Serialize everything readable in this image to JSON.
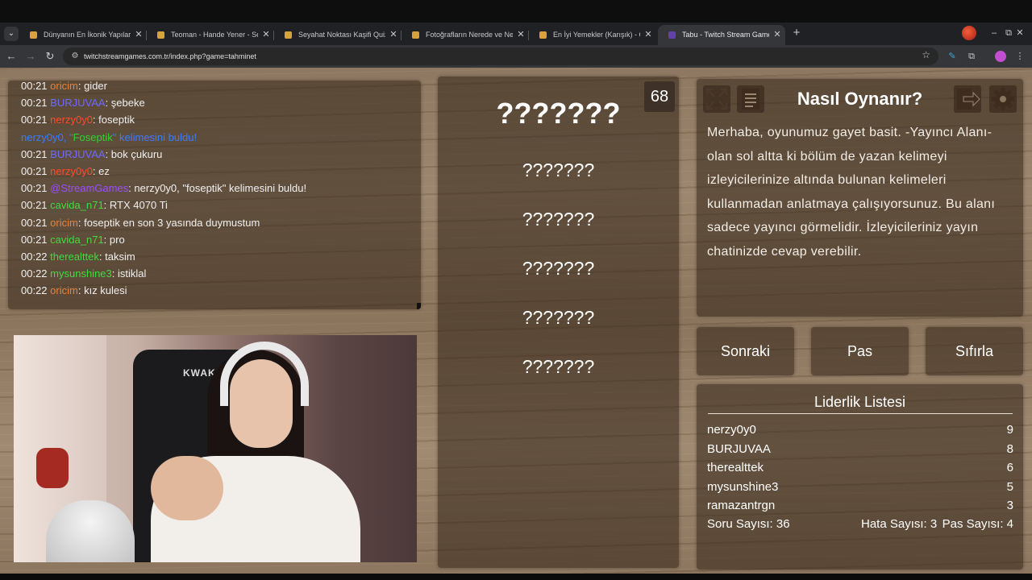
{
  "browser": {
    "tabs": [
      {
        "title": "Dünyanın En İkonik Yapıları [Tar",
        "favicon_color": "#d8a23a",
        "active": false
      },
      {
        "title": "Teoman - Hande Yener - Sezen",
        "favicon_color": "#d8a23a",
        "active": false
      },
      {
        "title": "Seyahat Noktası Kaşifi Quiz | Ne",
        "favicon_color": "#d8a23a",
        "active": false
      },
      {
        "title": "Fotoğrafların Nerede ve Ne Zam",
        "favicon_color": "#d8a23a",
        "active": false
      },
      {
        "title": "En İyi Yemekler (Karışık) - Quize",
        "favicon_color": "#d8a23a",
        "active": false
      },
      {
        "title": "Tabu - Twitch Stream Games",
        "favicon_color": "#6441a5",
        "active": true
      }
    ],
    "new_tab": "+",
    "url": "twitchstreamgames.com.tr/index.php?game=tahminet",
    "window": {
      "minimize": "–",
      "restore": "⧉",
      "close": "✕"
    }
  },
  "chat": {
    "messages": [
      {
        "time": "00:21",
        "user": "oricim",
        "color": "#e8823a",
        "sep": ": ",
        "text": "gider"
      },
      {
        "time": "00:21",
        "user": "BURJUVAA",
        "color": "#6b6bff",
        "sep": ": ",
        "text": "şebeke"
      },
      {
        "time": "00:21",
        "user": "nerzy0y0",
        "color": "#ff4a2a",
        "sep": ": ",
        "text": "foseptik"
      },
      {
        "time": "",
        "user": "nerzy0y0, \"",
        "color": "#3a7bff",
        "sep": "",
        "text": "Foseptik",
        "text_color": "#2fd32f",
        "suffix": "\" kelimesini buldu!",
        "suffix_color": "#3a7bff"
      },
      {
        "time": "00:21",
        "user": "BURJUVAA",
        "color": "#6b6bff",
        "sep": ": ",
        "text": "bok çukuru"
      },
      {
        "time": "00:21",
        "user": "nerzy0y0",
        "color": "#ff4a2a",
        "sep": ": ",
        "text": "ez"
      },
      {
        "time": "00:21",
        "user": "@StreamGames",
        "color": "#9b4dff",
        "sep": ": ",
        "text": "nerzy0y0, \"foseptik\" kelimesini buldu!"
      },
      {
        "time": "00:21",
        "user": "cavida_n71",
        "color": "#3fdc3f",
        "sep": ": ",
        "text": "RTX 4070 Ti"
      },
      {
        "time": "00:21",
        "user": "oricim",
        "color": "#e8823a",
        "sep": ": ",
        "text": "foseptik en son 3 yasında duymustum"
      },
      {
        "time": "00:21",
        "user": "cavida_n71",
        "color": "#3fdc3f",
        "sep": ": ",
        "text": "pro"
      },
      {
        "time": "00:22",
        "user": "therealttek",
        "color": "#3fdc3f",
        "sep": ": ",
        "text": "taksim"
      },
      {
        "time": "00:22",
        "user": "mysunshine3",
        "color": "#3fdc3f",
        "sep": ": ",
        "text": "istiklal"
      },
      {
        "time": "00:22",
        "user": "oricim",
        "color": "#e8823a",
        "sep": ": ",
        "text": "kız kulesi"
      }
    ]
  },
  "webcam": {
    "chair_logo": "KWAK"
  },
  "game": {
    "timer": "68",
    "main_word": "???????",
    "taboo_words": [
      "???????",
      "???????",
      "???????",
      "???????",
      "???????"
    ]
  },
  "info": {
    "title": "Nasıl Oynanır?",
    "description": "Merhaba, oyunumuz gayet basit. -Yayıncı Alanı- olan sol altta ki bölüm de yazan kelimeyi izleyicilerinize altında bulunan kelimeleri kullanmadan anlatmaya çalışıyorsunuz. Bu alanı sadece yayıncı görmelidir. İzleyicileriniz yayın chatinizde cevap verebilir."
  },
  "buttons": {
    "next": "Sonraki",
    "pass": "Pas",
    "reset": "Sıfırla"
  },
  "leaderboard": {
    "title": "Liderlik Listesi",
    "rows": [
      {
        "name": "nerzy0y0",
        "score": "9"
      },
      {
        "name": "BURJUVAA",
        "score": "8"
      },
      {
        "name": "therealttek",
        "score": "6"
      },
      {
        "name": "mysunshine3",
        "score": "5"
      },
      {
        "name": "ramazantrgn",
        "score": "3"
      }
    ],
    "question_count": "Soru Sayısı: 36",
    "error_count": "Hata Sayısı: 3",
    "pass_count": "Pas Sayısı: 4"
  }
}
